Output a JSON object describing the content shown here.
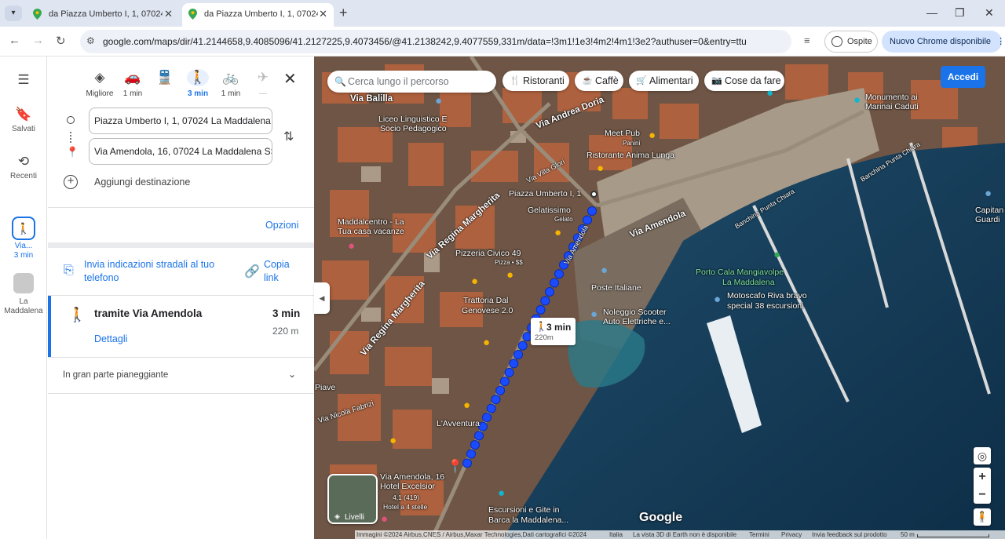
{
  "browser": {
    "tabs": [
      {
        "title": "da Piazza Umberto I, 1, 07024 La Maddalena",
        "active": false
      },
      {
        "title": "da Piazza Umberto I, 1, 07024 La Maddalena",
        "active": true
      }
    ],
    "url": "google.com/maps/dir/41.2144658,9.4085096/41.2127225,9.4073456/@41.2138242,9.4077559,331m/data=!3m1!1e3!4m2!4m1!3e2?authuser=0&entry=ttu",
    "guest_label": "Ospite",
    "update_label": "Nuovo Chrome disponibile"
  },
  "rail": {
    "menu_icon": "menu-icon",
    "saved": "Salvati",
    "recent": "Recenti",
    "walk_label_1": "Via...",
    "walk_label_2": "3 min",
    "place_label_1": "La",
    "place_label_2": "Maddalena"
  },
  "directions": {
    "modes": [
      {
        "name": "best",
        "label": "Migliore",
        "icon": "diamond-route-icon"
      },
      {
        "name": "car",
        "label": "1 min",
        "icon": "car-icon"
      },
      {
        "name": "transit",
        "label": "",
        "icon": "train-icon"
      },
      {
        "name": "walk",
        "label": "3 min",
        "icon": "walk-icon"
      },
      {
        "name": "bike",
        "label": "1 min",
        "icon": "bike-icon"
      },
      {
        "name": "flight",
        "label": "—",
        "icon": "plane-icon"
      }
    ],
    "origin": "Piazza Umberto I, 1, 07024 La Maddalena",
    "destination": "Via Amendola, 16, 07024 La Maddalena SS",
    "add_destination": "Aggiungi destinazione",
    "options": "Opzioni",
    "send_to_phone": "Invia indicazioni stradali al tuo telefono",
    "copy_link": "Copia link",
    "route": {
      "title": "tramite Via Amendola",
      "time": "3 min",
      "distance": "220 m",
      "details": "Dettagli"
    },
    "terrain_note": "In gran parte pianeggiante"
  },
  "map": {
    "search_placeholder": "Cerca lungo il percorso",
    "chips": [
      "Ristoranti",
      "Caffè",
      "Alimentari",
      "Cose da fare"
    ],
    "signin": "Accedi",
    "popup_time": "3 min",
    "popup_distance": "220m",
    "layers_label": "Livelli",
    "brand": "Google",
    "labels": {
      "via_balilla": "Via Balilla",
      "liceo_1": "Liceo Linguistico E",
      "liceo_2": "Socio Pedagogico",
      "via_andrea_doria": "Via Andrea Doria",
      "meet_pub_1": "Meet Pub",
      "meet_pub_2": "Panini",
      "ristorante": "Ristorante Anima Lunga",
      "via_villa_glori": "Via Villa Glori",
      "piazza_umberto": "Piazza Umberto I, 1",
      "gelatissimo_1": "Gelatissimo",
      "gelatissimo_2": "Gelato",
      "maddalcentro_1": "Maddalcentro - La",
      "maddalcentro_2": "Tua casa vacanze",
      "via_regina_margherita": "Via Regina Margherita",
      "pizzeria_1": "Pizzeria Civico 49",
      "pizzeria_2": "Pizza • $$",
      "via_amendola_a": "Via Amendola",
      "via_amendola_b": "Via Amendola",
      "trattoria_1": "Trattoria Dal",
      "trattoria_2": "Genovese 2.0",
      "poste": "Poste Italiane",
      "noleggio_1": "Noleggio Scooter",
      "noleggio_2": "Auto Elettriche e...",
      "porto_1": "Porto Cala Mangiavolpe",
      "porto_2": "La Maddalena",
      "motoscafo_1": "Motoscafo Riva bravo",
      "motoscafo_2": "special 38 escursioni",
      "monumento_1": "Monumento ai",
      "monumento_2": "Marinai Caduti",
      "banchina_1": "Banchina Punta Chiara",
      "banchina_2": "Banchina Punta Chiara",
      "capitaneria_1": "Capitan",
      "capitaneria_2": "Guardi",
      "piave": "Piave",
      "nicola_fabrizi": "Via Nicola Fabrizi",
      "avventura": "L'Avventura",
      "via_amendola_16": "Via Amendola, 16",
      "hotel_1": "Hotel Excelsior",
      "hotel_2": "4,1 (419)",
      "hotel_3": "Hotel a 4 stelle",
      "escursioni_1": "Escursioni e Gite in",
      "escursioni_2": "Barca la Maddalena..."
    },
    "footer": {
      "attribution": "Immagini ©2024 Airbus,CNES / Airbus,Maxar Technologies,Dati cartografici ©2024",
      "country": "Italia",
      "earth": "La vista 3D di Earth non è disponibile",
      "terms": "Termini",
      "privacy": "Privacy",
      "feedback": "Invia feedback sul prodotto",
      "scale": "50 m"
    },
    "route_color": "#1a4bff",
    "accent": "#1a73e8"
  }
}
